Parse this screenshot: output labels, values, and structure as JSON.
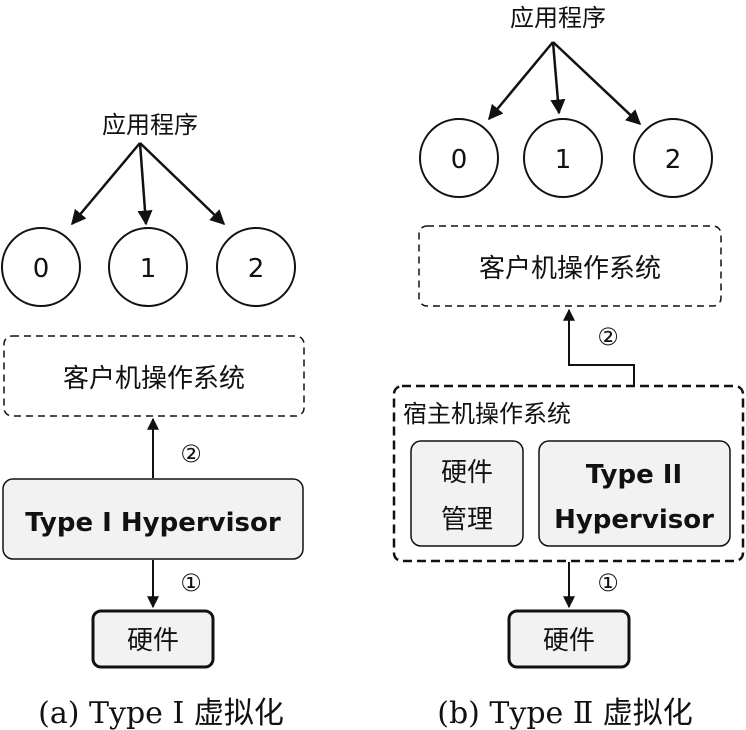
{
  "panel_a": {
    "app_label": "应用程序",
    "circles": [
      "0",
      "1",
      "2"
    ],
    "guest_os": "客户机操作系统",
    "step_2": "②",
    "hypervisor": "Type I Hypervisor",
    "step_1": "①",
    "hardware": "硬件",
    "caption": "(a) Type Ⅰ 虚拟化"
  },
  "panel_b": {
    "app_label": "应用程序",
    "circles": [
      "0",
      "1",
      "2"
    ],
    "guest_os": "客户机操作系统",
    "step_2": "②",
    "host_os": "宿主机操作系统",
    "hw_mgmt_line1": "硬件",
    "hw_mgmt_line2": "管理",
    "hypervisor_line1": "Type II",
    "hypervisor_line2": "Hypervisor",
    "step_1": "①",
    "hardware": "硬件",
    "caption": "(b) Type Ⅱ 虚拟化"
  }
}
